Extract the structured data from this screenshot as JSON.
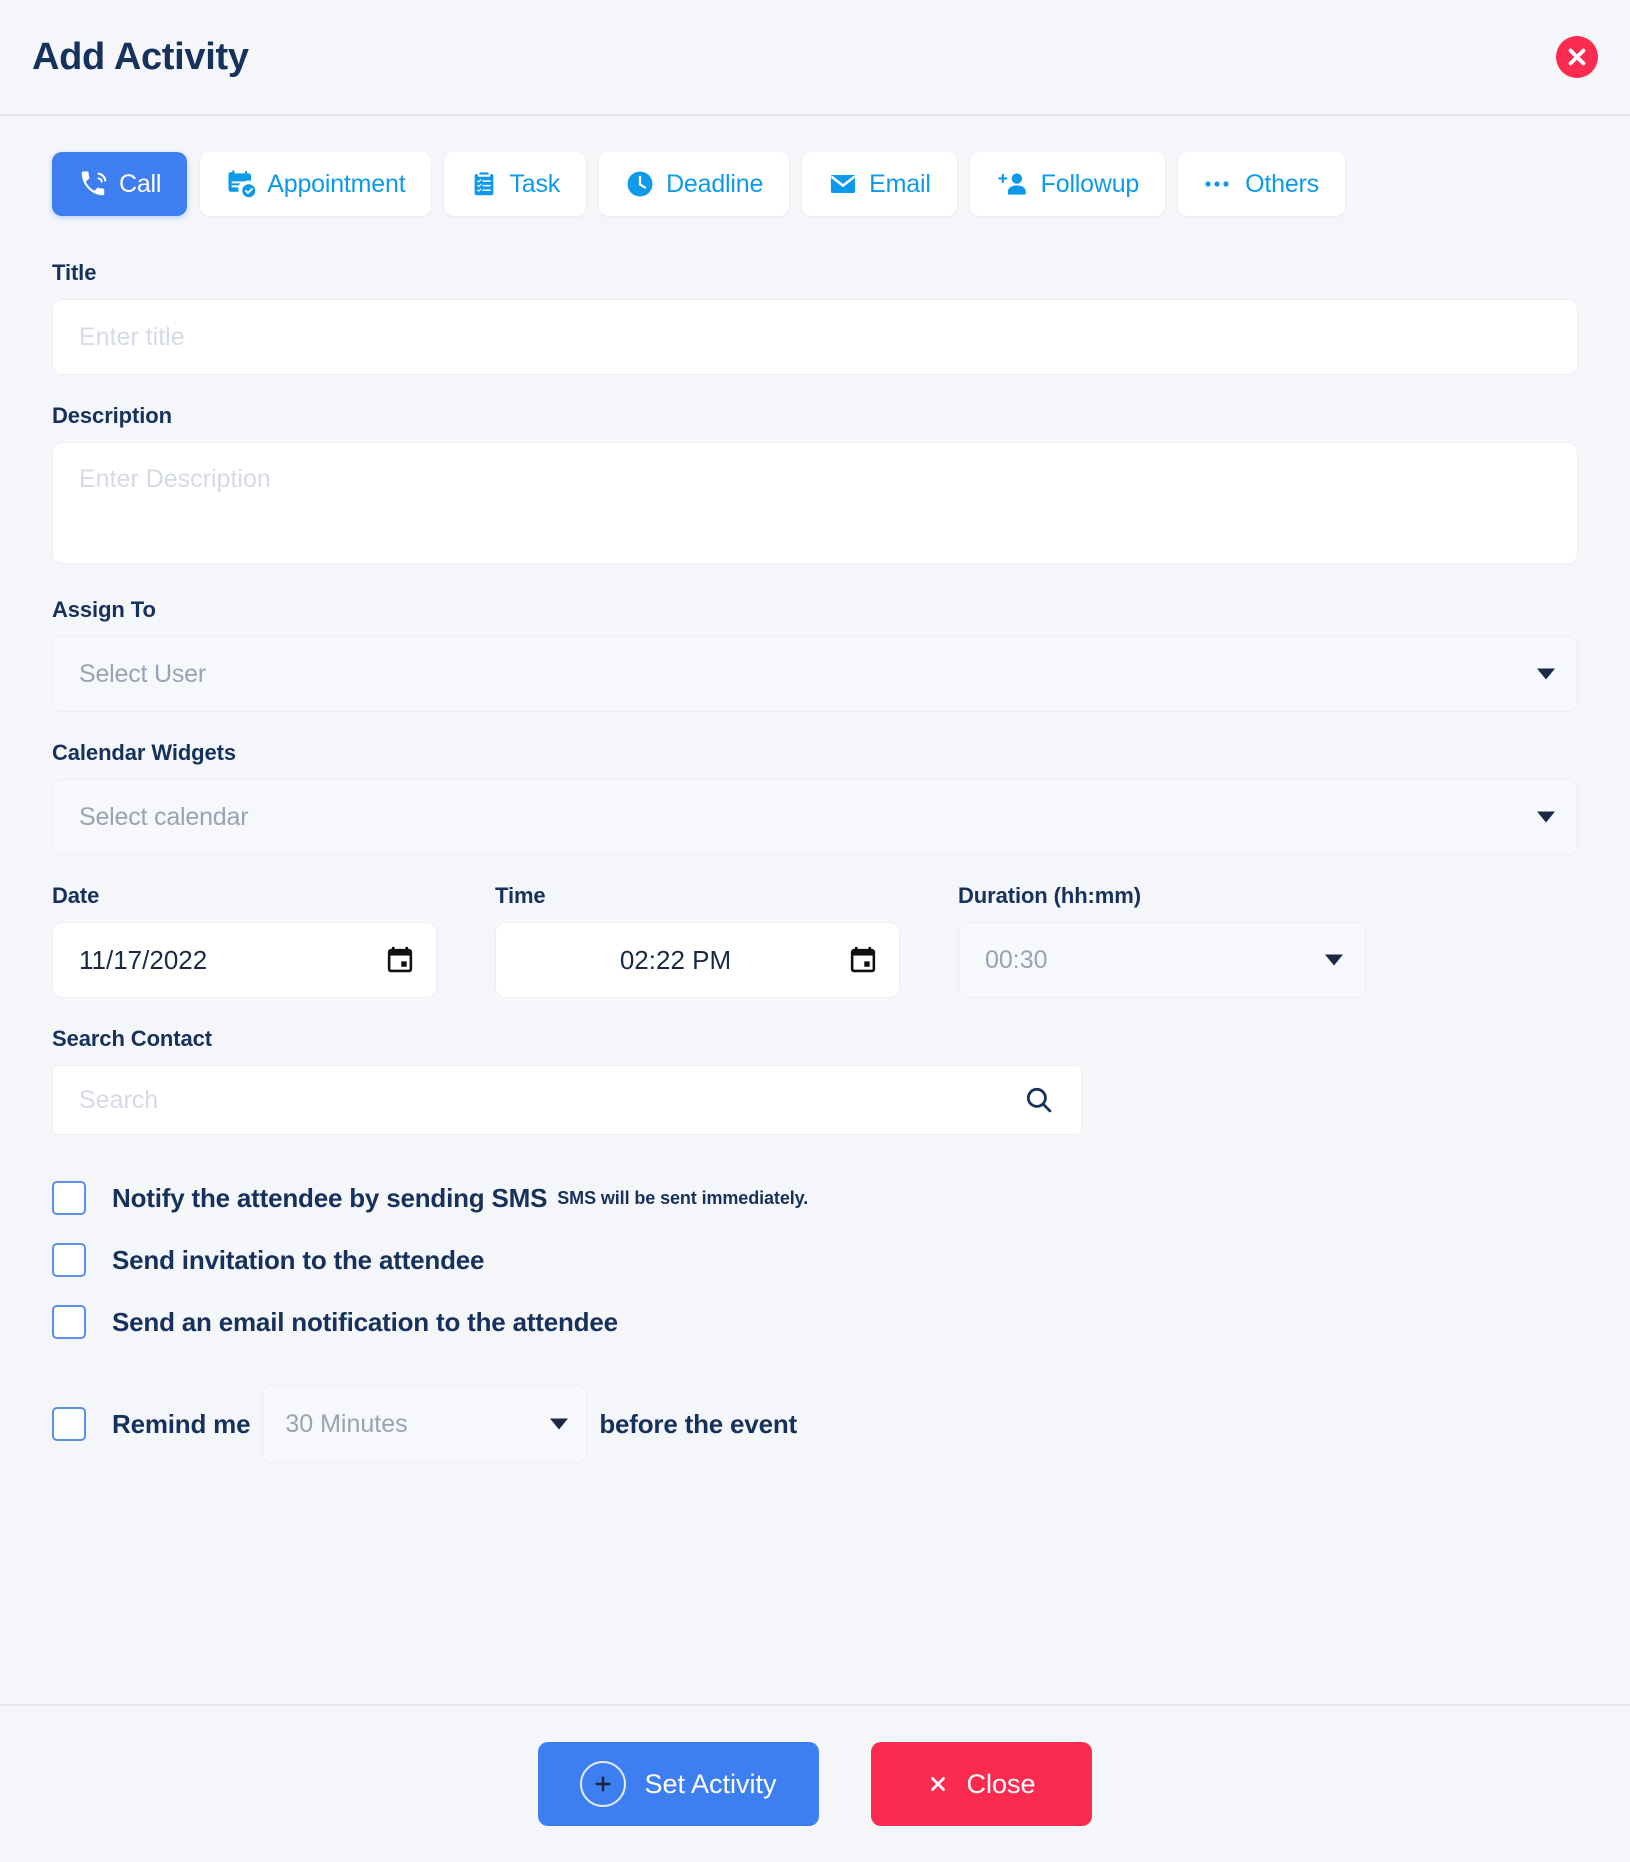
{
  "header": {
    "title": "Add Activity",
    "close_icon": "close-circle-icon"
  },
  "tabs": [
    {
      "label": "Call",
      "icon": "phone-ringing-icon",
      "active": true
    },
    {
      "label": "Appointment",
      "icon": "calendar-check-icon",
      "active": false
    },
    {
      "label": "Task",
      "icon": "clipboard-list-icon",
      "active": false
    },
    {
      "label": "Deadline",
      "icon": "clock-icon",
      "active": false
    },
    {
      "label": "Email",
      "icon": "envelope-icon",
      "active": false
    },
    {
      "label": "Followup",
      "icon": "person-add-icon",
      "active": false
    },
    {
      "label": "Others",
      "icon": "ellipsis-icon",
      "active": false
    }
  ],
  "form": {
    "title": {
      "label": "Title",
      "value": "",
      "placeholder": "Enter title"
    },
    "description": {
      "label": "Description",
      "value": "",
      "placeholder": "Enter Description"
    },
    "assign_to": {
      "label": "Assign To",
      "value": "Select User"
    },
    "calendar_widgets": {
      "label": "Calendar Widgets",
      "value": "Select calendar"
    },
    "date": {
      "label": "Date",
      "value": "11/17/2022",
      "icon": "calendar-icon"
    },
    "time": {
      "label": "Time",
      "value": "02:22 PM",
      "icon": "calendar-icon"
    },
    "duration": {
      "label": "Duration (hh:mm)",
      "value": "00:30"
    },
    "search_contact": {
      "label": "Search Contact",
      "value": "",
      "placeholder": "Search",
      "icon": "search-icon"
    }
  },
  "checkboxes": [
    {
      "label": "Notify the attendee by sending SMS",
      "hint": "SMS will be sent immediately.",
      "checked": false
    },
    {
      "label": "Send invitation to the attendee",
      "hint": "",
      "checked": false
    },
    {
      "label": "Send an email notification to the attendee",
      "hint": "",
      "checked": false
    }
  ],
  "remind": {
    "prefix": "Remind me",
    "value": "30 Minutes",
    "suffix": "before the event",
    "checked": false
  },
  "footer": {
    "primary_label": "Set Activity",
    "primary_icon": "plus-circle-icon",
    "close_label": "Close",
    "close_icon": "x-icon"
  },
  "colors": {
    "accent_blue": "#3d7ef0",
    "tab_blue": "#0d9ae8",
    "danger_red": "#fb2a4f",
    "text_navy": "#16325c",
    "page_bg": "#f4f6fa"
  }
}
